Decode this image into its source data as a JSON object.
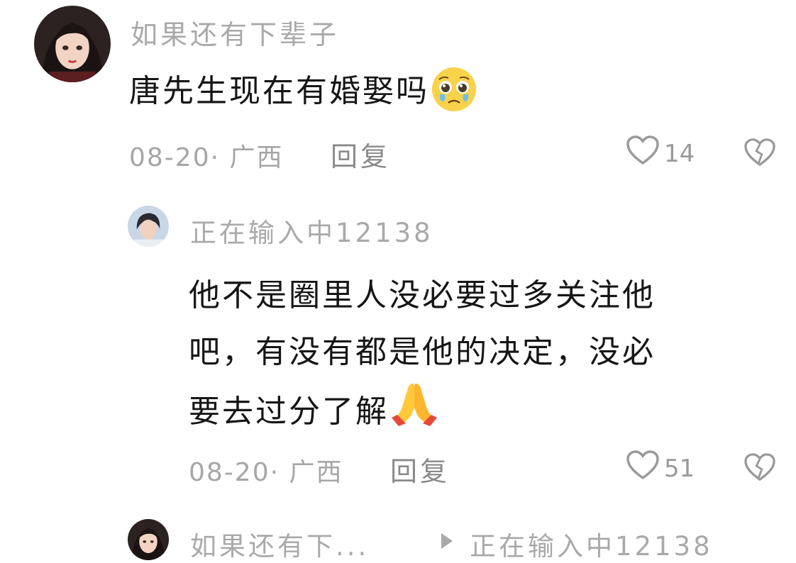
{
  "comment": {
    "username": "如果还有下辈子",
    "text": "唐先生现在有婚娶吗",
    "date": "08-20",
    "dot": "·",
    "location": "广西",
    "reply_label": "回复",
    "likes": "14",
    "emoji": "pleading-face-emoji"
  },
  "reply": {
    "username": "正在输入中12138",
    "text_lines": [
      "他不是圈里人没必要过多关注他",
      "吧，有没有都是他的决定，没必",
      "要去过分了解"
    ],
    "date": "08-20",
    "dot": "·",
    "location": "广西",
    "reply_label": "回复",
    "likes": "51",
    "emoji": "folded-hands-emoji"
  },
  "next_reply": {
    "from_user": "如果还有下...",
    "to_user": "正在输入中12138"
  }
}
